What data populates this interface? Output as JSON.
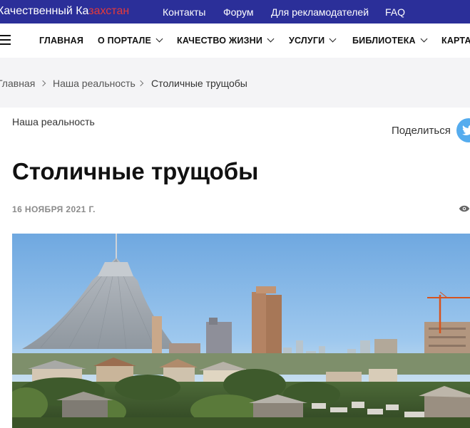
{
  "site": {
    "brand_part1": "Качественный Ка",
    "brand_part2": "захстан",
    "top_links": [
      "Контакты",
      "Форум",
      "Для рекламодателей",
      "FAQ"
    ]
  },
  "nav": {
    "items": [
      {
        "label": "ГЛАВНАЯ",
        "dropdown": false
      },
      {
        "label": "О ПОРТАЛЕ",
        "dropdown": true
      },
      {
        "label": "КАЧЕСТВО ЖИЗНИ",
        "dropdown": true
      },
      {
        "label": "УСЛУГИ",
        "dropdown": true
      },
      {
        "label": "БИБЛИОТЕКА",
        "dropdown": true
      },
      {
        "label": "КАРТА",
        "dropdown": false
      }
    ]
  },
  "breadcrumb": [
    "Главная",
    "Наша реальность",
    "Столичные трущобы"
  ],
  "article": {
    "category": "Наша реальность",
    "share_label": "Поделиться",
    "title": "Столичные трущобы",
    "date": "16 НОЯБРЯ 2021 Г."
  },
  "colors": {
    "topbar": "#2b2f99",
    "brand_accent": "#e63a3a",
    "breadcrumb_bg": "#f4f4f6",
    "twitter": "#55acee"
  },
  "icons": [
    "menu-icon",
    "chevron-down-icon",
    "chevron-right-icon",
    "twitter-icon",
    "eye-icon"
  ]
}
